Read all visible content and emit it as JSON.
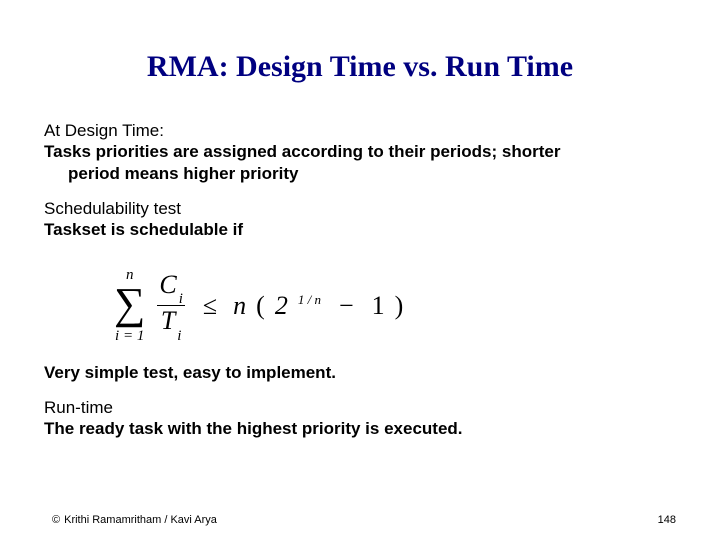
{
  "title": "RMA: Design Time vs. Run Time",
  "section1": {
    "heading": "At Design Time:",
    "line1": "Tasks priorities are assigned according to their periods; shorter",
    "line2": "period means higher priority"
  },
  "section2": {
    "heading": "Schedulability test",
    "line1": "Taskset is schedulable if"
  },
  "formula": {
    "sum_upper": "n",
    "sum_lower": "i = 1",
    "frac_num_var": "C",
    "frac_num_sub": "i",
    "frac_den_var": "T",
    "frac_den_sub": "i",
    "leq": "≤",
    "rhs_n": "n",
    "lparen": "(",
    "base": "2",
    "exp": "1 / n",
    "minus": "−",
    "one": "1",
    "rparen": ")"
  },
  "section3": {
    "line1": "Very simple test, easy to implement."
  },
  "section4": {
    "heading": "Run-time",
    "line1": "The ready task with the highest priority is executed."
  },
  "footer": {
    "copyright_symbol": "©",
    "credit": "Krithi Ramamritham / Kavi Arya",
    "page": "148"
  }
}
